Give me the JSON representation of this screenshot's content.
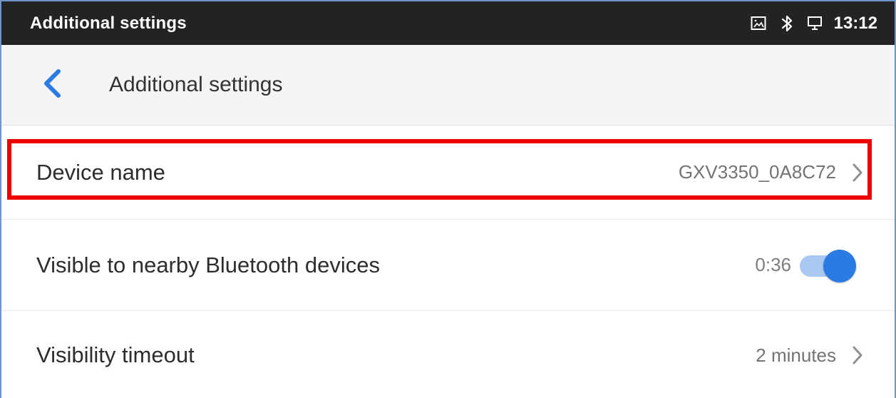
{
  "status_bar": {
    "title": "Additional settings",
    "time": "13:12",
    "icons": [
      "gallery-icon",
      "bluetooth-icon",
      "monitor-icon"
    ]
  },
  "header": {
    "title": "Additional settings",
    "back_icon": "chevron-left-icon"
  },
  "settings": {
    "device_name": {
      "label": "Device name",
      "value": "GXV3350_0A8C72",
      "chevron": "chevron-right-icon"
    },
    "visibility": {
      "label": "Visible to nearby Bluetooth devices",
      "countdown": "0:36",
      "enabled": true
    },
    "visibility_timeout": {
      "label": "Visibility timeout",
      "value": "2 minutes",
      "chevron": "chevron-right-icon"
    }
  },
  "colors": {
    "status_bar_bg": "#232323",
    "app_bar_bg": "#f3f4f4",
    "accent_blue": "#2b7be4",
    "highlight_red": "#ef0000"
  }
}
